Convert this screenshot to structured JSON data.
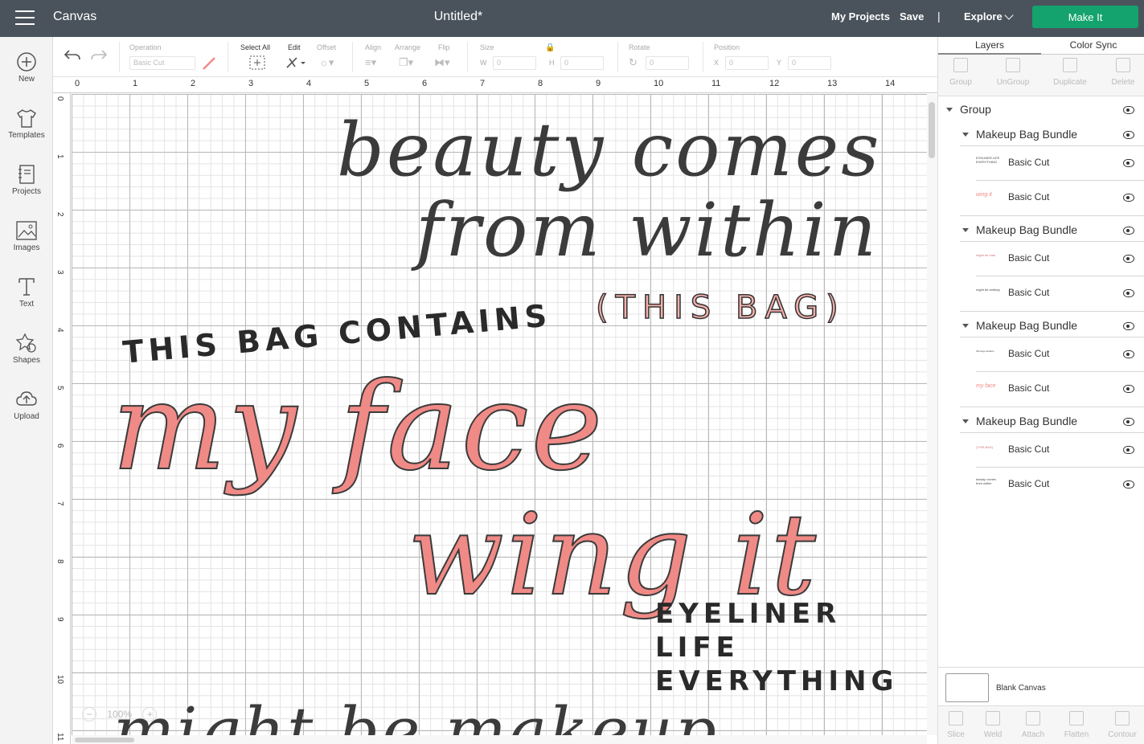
{
  "topbar": {
    "brand": "Canvas",
    "doc_title": "Untitled*",
    "my_projects": "My Projects",
    "save": "Save",
    "separator": "|",
    "explore": "Explore",
    "make_it": "Make It",
    "accent": "#14a36e",
    "bg": "#4a535c"
  },
  "sidebar": {
    "items": [
      {
        "label": "New",
        "icon": "plus-circle-icon"
      },
      {
        "label": "Templates",
        "icon": "tshirt-icon"
      },
      {
        "label": "Projects",
        "icon": "notebook-icon"
      },
      {
        "label": "Images",
        "icon": "image-icon"
      },
      {
        "label": "Text",
        "icon": "text-icon"
      },
      {
        "label": "Shapes",
        "icon": "shapes-icon"
      },
      {
        "label": "Upload",
        "icon": "cloud-upload-icon"
      }
    ]
  },
  "toolbar": {
    "operation_label": "Operation",
    "operation_value": "Basic Cut",
    "select_all": "Select All",
    "edit": "Edit",
    "offset": "Offset",
    "align": "Align",
    "arrange": "Arrange",
    "flip": "Flip",
    "size": "Size",
    "w_label": "W",
    "w_value": "0",
    "h_label": "H",
    "h_value": "0",
    "rotate": "Rotate",
    "rotate_value": "0",
    "position": "Position",
    "x_label": "X",
    "x_value": "0",
    "y_label": "Y",
    "y_value": "0"
  },
  "ruler": {
    "x_ticks": [
      "0",
      "1",
      "2",
      "3",
      "4",
      "5",
      "6",
      "7",
      "8",
      "9",
      "10",
      "11",
      "12",
      "13",
      "14"
    ],
    "y_ticks": [
      "0",
      "1",
      "2",
      "3",
      "4",
      "5",
      "6",
      "7",
      "8",
      "9",
      "10",
      "11"
    ]
  },
  "canvas": {
    "zoom_minus": "−",
    "zoom": "100%",
    "zoom_plus": "+",
    "texts": {
      "beauty": "beauty comes",
      "from_within": "from within",
      "this_bag": "(THIS BAG)",
      "contains": "THIS BAG CONTAINS",
      "my_face": "my face",
      "wing_it": "wing it",
      "eyeliner": "EYELINER",
      "life": "LIFE",
      "everything": "EVERYTHING",
      "might_be": "might be makeup"
    },
    "colors": {
      "pink": "#f08a86",
      "dark": "#3b3b3b"
    }
  },
  "panel": {
    "tab_layers": "Layers",
    "tab_color_sync": "Color Sync",
    "actions": [
      "Group",
      "UnGroup",
      "Duplicate",
      "Delete"
    ],
    "group_label": "Group",
    "bundles": [
      {
        "name": "Makeup Bag Bundle",
        "items": [
          {
            "label": "Basic Cut",
            "thumb": "EYELINER LIFE EVERYTHING"
          },
          {
            "label": "Basic Cut",
            "thumb": "wing it"
          }
        ]
      },
      {
        "name": "Makeup Bag Bundle",
        "items": [
          {
            "label": "Basic Cut",
            "thumb": "might be mak"
          },
          {
            "label": "Basic Cut",
            "thumb": "might be nothing"
          }
        ]
      },
      {
        "name": "Makeup Bag Bundle",
        "items": [
          {
            "label": "Basic Cut",
            "thumb": "this bag contains"
          },
          {
            "label": "Basic Cut",
            "thumb": "my face"
          }
        ]
      },
      {
        "name": "Makeup Bag Bundle",
        "items": [
          {
            "label": "Basic Cut",
            "thumb": "(THIS BAG)"
          },
          {
            "label": "Basic Cut",
            "thumb": "beauty comes from within"
          }
        ]
      }
    ],
    "blank_canvas": "Blank Canvas",
    "bottom_actions": [
      "Slice",
      "Weld",
      "Attach",
      "Flatten",
      "Contour"
    ]
  }
}
